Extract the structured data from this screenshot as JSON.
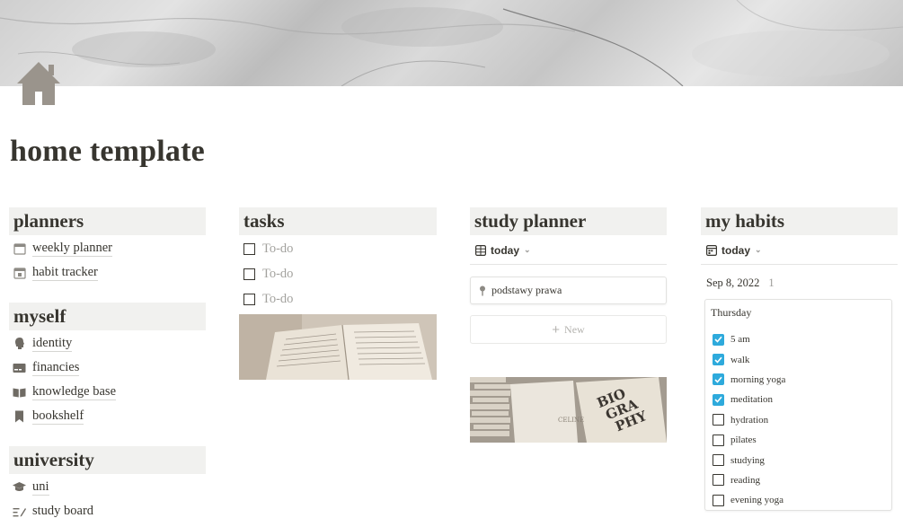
{
  "page": {
    "title": "home template"
  },
  "icons": {
    "page_icon": "house-icon"
  },
  "colors": {
    "accent": "#2eaadc",
    "header_bg": "#f1f1ef",
    "text": "#37352f",
    "muted": "#a3a29e"
  },
  "planners": {
    "header": "planners",
    "links": [
      {
        "label": "weekly planner",
        "icon": "calendar-icon"
      },
      {
        "label": "habit tracker",
        "icon": "calendar-check-icon"
      }
    ]
  },
  "myself": {
    "header": "myself",
    "links": [
      {
        "label": "identity",
        "icon": "profile-head-icon"
      },
      {
        "label": "financies",
        "icon": "card-icon"
      },
      {
        "label": "knowledge base",
        "icon": "open-book-icon"
      },
      {
        "label": "bookshelf",
        "icon": "bookmark-icon"
      }
    ]
  },
  "university": {
    "header": "university",
    "links": [
      {
        "label": "uni",
        "icon": "graduation-cap-icon"
      },
      {
        "label": "study board",
        "icon": "pencil-lines-icon"
      }
    ]
  },
  "tasks": {
    "header": "tasks",
    "todos": [
      {
        "label": "To-do",
        "checked": false
      },
      {
        "label": "To-do",
        "checked": false
      },
      {
        "label": "To-do",
        "checked": false
      }
    ]
  },
  "study_planner": {
    "header": "study planner",
    "view_label": "today",
    "items": [
      {
        "label": "podstawy prawa",
        "icon": "pin-icon"
      }
    ],
    "new_label": "New"
  },
  "habits": {
    "header": "my habits",
    "view_label": "today",
    "date": "Sep 8, 2022",
    "count": "1",
    "card_title": "Thursday",
    "items": [
      {
        "label": "5 am",
        "checked": true
      },
      {
        "label": "walk",
        "checked": true
      },
      {
        "label": "morning yoga",
        "checked": true
      },
      {
        "label": "meditation",
        "checked": true
      },
      {
        "label": "hydration",
        "checked": false
      },
      {
        "label": "pilates",
        "checked": false
      },
      {
        "label": "studying",
        "checked": false
      },
      {
        "label": "reading",
        "checked": false
      },
      {
        "label": "evening yoga",
        "checked": false
      }
    ]
  }
}
